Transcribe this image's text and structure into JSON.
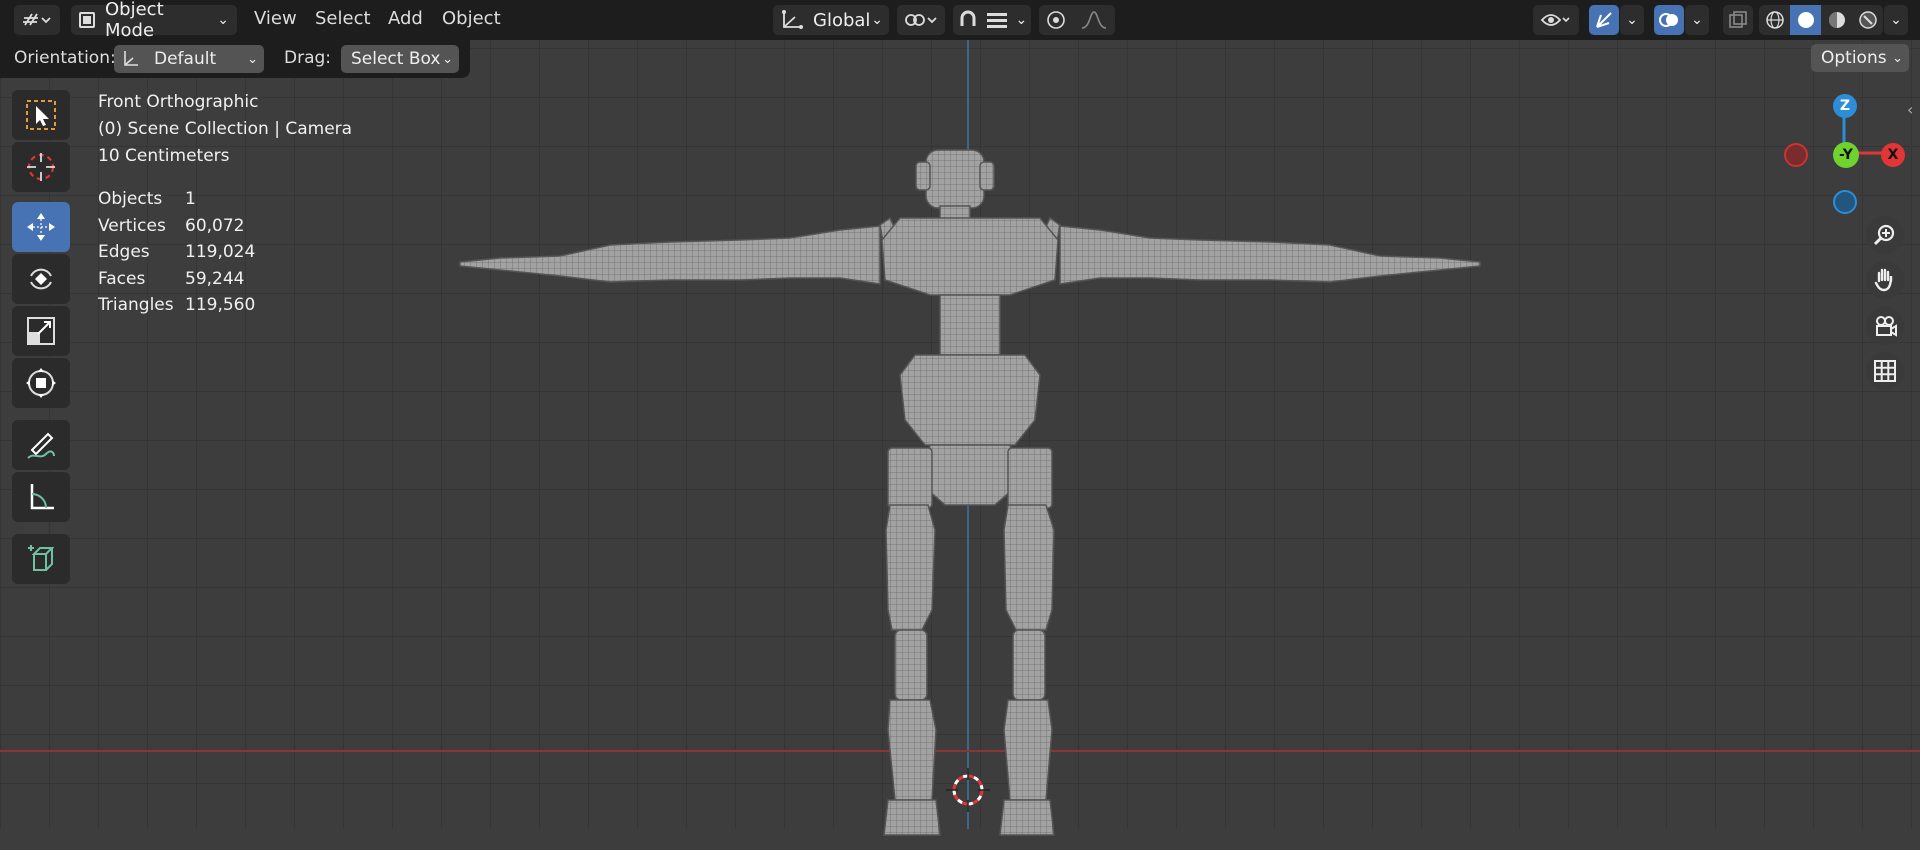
{
  "header": {
    "mode_label": "Object Mode",
    "menus": [
      "View",
      "Select",
      "Add",
      "Object"
    ],
    "transform_orientation": "Global"
  },
  "options_bar": {
    "orientation_label": "Orientation:",
    "orientation_value": "Default",
    "drag_label": "Drag:",
    "drag_value": "Select Box",
    "options_button": "Options"
  },
  "viewport": {
    "view_name": "Front Orthographic",
    "collection": "(0) Scene Collection | Camera",
    "grid_scale": "10 Centimeters",
    "stats": [
      {
        "label": "Objects",
        "value": "1"
      },
      {
        "label": "Vertices",
        "value": "60,072"
      },
      {
        "label": "Edges",
        "value": "119,024"
      },
      {
        "label": "Faces",
        "value": "59,244"
      },
      {
        "label": "Triangles",
        "value": "119,560"
      }
    ]
  },
  "gizmo": {
    "z": "Z",
    "y": "-Y",
    "x": "X"
  },
  "colors": {
    "accent": "#4772b3",
    "x_axis": "#e23535",
    "y_axis": "#6fd22f",
    "z_axis": "#2d8dd6"
  },
  "icons": [
    "editor-type-icon",
    "select-box-icon",
    "cursor-icon",
    "move-icon",
    "rotate-icon",
    "scale-icon",
    "transform-icon",
    "annotate-icon",
    "measure-icon",
    "add-cube-icon",
    "zoom-icon",
    "hand-icon",
    "camera-icon",
    "grid-icon"
  ]
}
